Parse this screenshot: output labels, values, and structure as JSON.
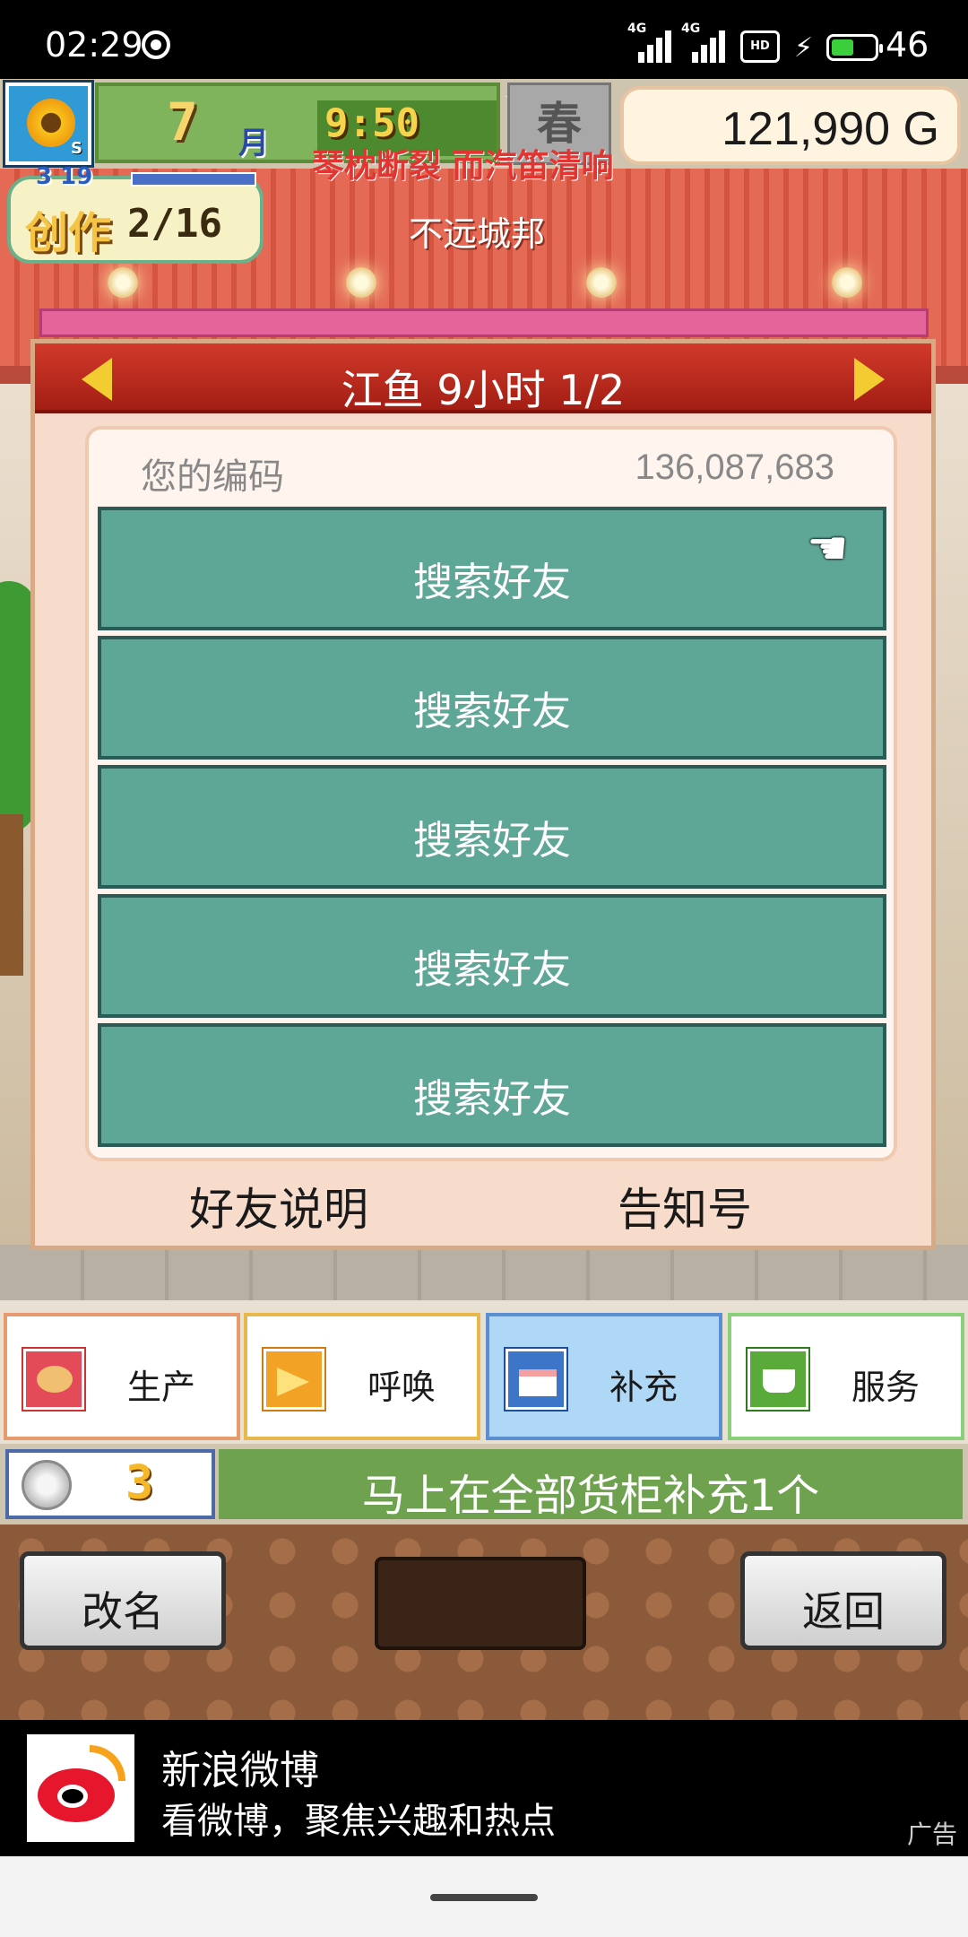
{
  "status_bar": {
    "time": "02:29",
    "network_1": "4G",
    "network_2": "4G",
    "hd_label": "HD",
    "battery": "46"
  },
  "hud": {
    "month_number": "7",
    "month_label": "月",
    "clock": "9:50",
    "season_label": "春",
    "money": "121,990 G",
    "banner_text": "琴枕断裂 而汽笛清响",
    "store_name": "不远城邦",
    "create_label": "创作",
    "create_progress": "2/16",
    "create_small": "3 19"
  },
  "dialog": {
    "title": "江鱼  9小时 1/2",
    "code_label": "您的编码",
    "code_value": "136,087,683",
    "friend_buttons": [
      "搜索好友",
      "搜索好友",
      "搜索好友",
      "搜索好友",
      "搜索好友"
    ],
    "link_left": "好友说明",
    "link_right": "告知号"
  },
  "tabs": [
    {
      "label": "生产",
      "icon": "bread-icon",
      "active": false
    },
    {
      "label": "呼唤",
      "icon": "megaphone-icon",
      "active": false
    },
    {
      "label": "补充",
      "icon": "cake-icon",
      "active": true
    },
    {
      "label": "服务",
      "icon": "coffee-cup-icon",
      "active": false
    }
  ],
  "bottom": {
    "coin_count": "3",
    "hint": "马上在全部货柜补充1个",
    "rename_label": "改名",
    "back_label": "返回"
  },
  "ad": {
    "title": "新浪微博",
    "subtitle": "看微博，聚焦兴趣和热点",
    "tag": "广告"
  },
  "colors": {
    "accent_teal": "#5ea797",
    "header_red": "#c12d20",
    "active_tab": "#aed8f6"
  }
}
